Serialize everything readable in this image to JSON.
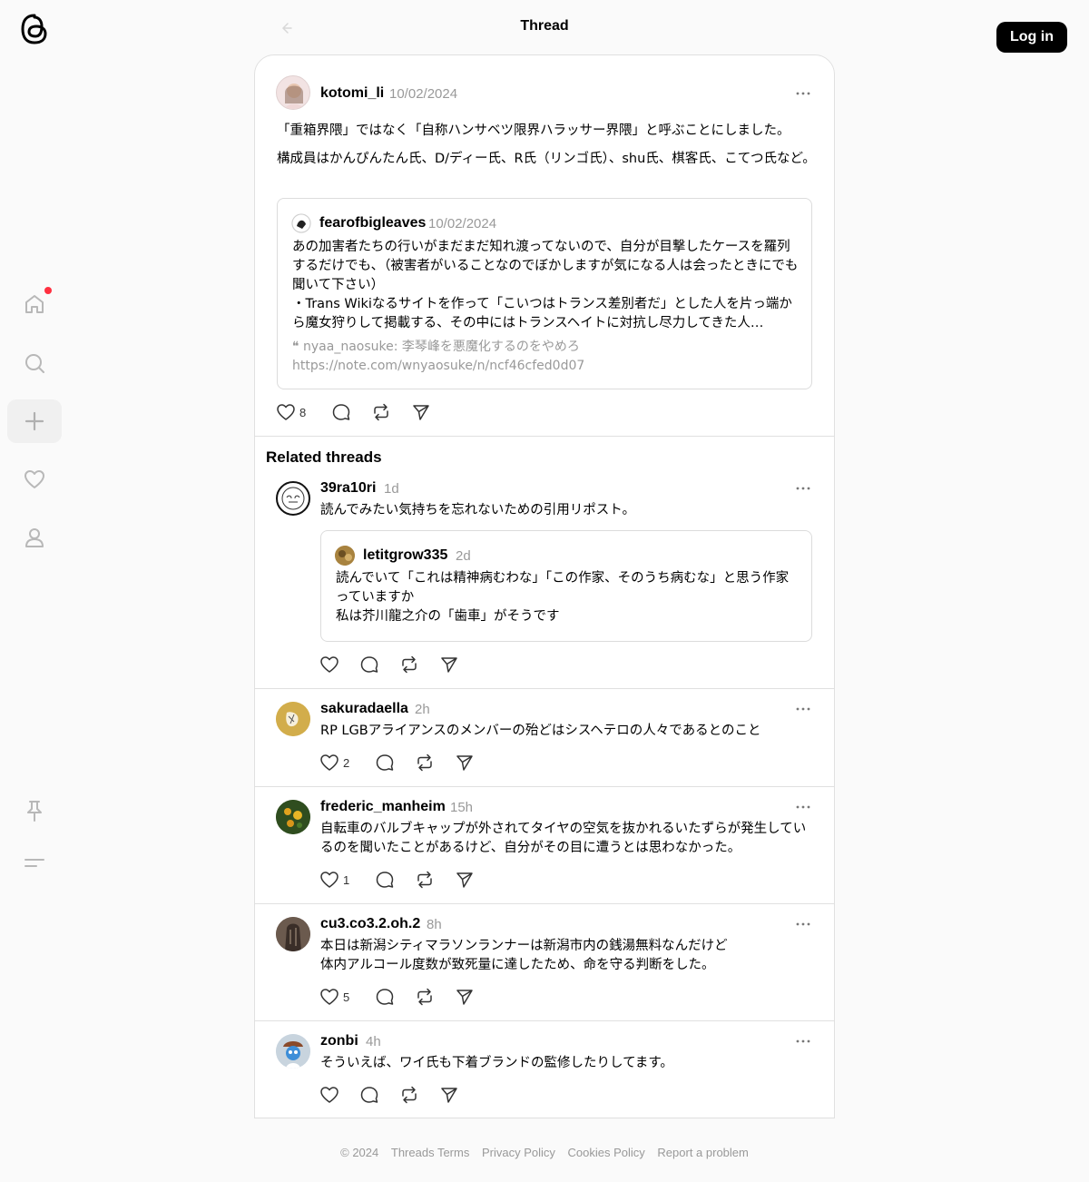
{
  "header": {
    "title": "Thread",
    "login_label": "Log in"
  },
  "main_post": {
    "username": "kotomi_li",
    "time": "10/02/2024",
    "text_p1": "「重箱界隈」ではなく「自称ハンサベツ限界ハラッサー界隈」と呼ぶことにしました。",
    "text_p2": "構成員はかんぴんたん氏、D/ディー氏、R氏（リンゴ氏）、shu氏、棋客氏、こてつ氏など。",
    "likes": "8",
    "quote": {
      "username": "fearofbigleaves",
      "time": "10/02/2024",
      "text": "あの加害者たちの行いがまだまだ知れ渡ってないので、自分が目撃したケースを羅列するだけでも、（被害者がいることなのでぼかしますが気になる人は会ったときにでも聞いて下さい）\n・Trans Wikiなるサイトを作って「こいつはトランス差別者だ」とした人を片っ端から魔女狩りして掲載する、その中にはトランスヘイトに対抗し尽力してきた人…",
      "subquote_glyph": "❝",
      "subquote": "nyaa_naosuke: 李琴峰を悪魔化するのをやめろ",
      "link": "https://note.com/wnyaosuke/n/ncf46cfed0d07"
    }
  },
  "related": {
    "title": "Related threads",
    "posts": [
      {
        "username": "39ra10ri",
        "time": "1d",
        "text": "読んでみたい気持ちを忘れないための引用リポスト。",
        "quote": {
          "username": "letitgrow335",
          "time": "2d",
          "text": "読んでいて「これは精神病むわな」「この作家、そのうち病むな」と思う作家っていますか\n私は芥川龍之介の「歯車」がそうです"
        }
      },
      {
        "username": "sakuradaella",
        "time": "2h",
        "text": "RP LGBアライアンスのメンバーの殆どはシスヘテロの人々であるとのこと",
        "likes": "2"
      },
      {
        "username": "frederic_manheim",
        "time": "15h",
        "text": "自転車のバルブキャップが外されてタイヤの空気を抜かれるいたずらが発生しているのを聞いたことがあるけど、自分がその目に遭うとは思わなかった。",
        "likes": "1"
      },
      {
        "username": "cu3.co3.2.oh.2",
        "time": "8h",
        "text": "本日は新潟シティマラソンランナーは新潟市内の銭湯無料なんだけど\n体内アルコール度数が致死量に達したため、命を守る判断をした。",
        "likes": "5"
      },
      {
        "username": "zonbi",
        "time": "4h",
        "text": "そういえば、ワイ氏も下着ブランドの監修したりしてます。"
      }
    ]
  },
  "footer": {
    "copyright": "© 2024",
    "terms": "Threads Terms",
    "privacy": "Privacy Policy",
    "cookies": "Cookies Policy",
    "report": "Report a problem"
  },
  "icons": {
    "logo": "threads-logo-icon",
    "home": "home-icon",
    "search": "search-icon",
    "create": "plus-icon",
    "activity": "heart-icon",
    "profile": "person-icon",
    "pin": "pin-icon",
    "menu": "menu-icon"
  },
  "colors": {
    "notification_dot": "#ff3040",
    "muted_text": "#999999",
    "login_button": "#000000"
  }
}
